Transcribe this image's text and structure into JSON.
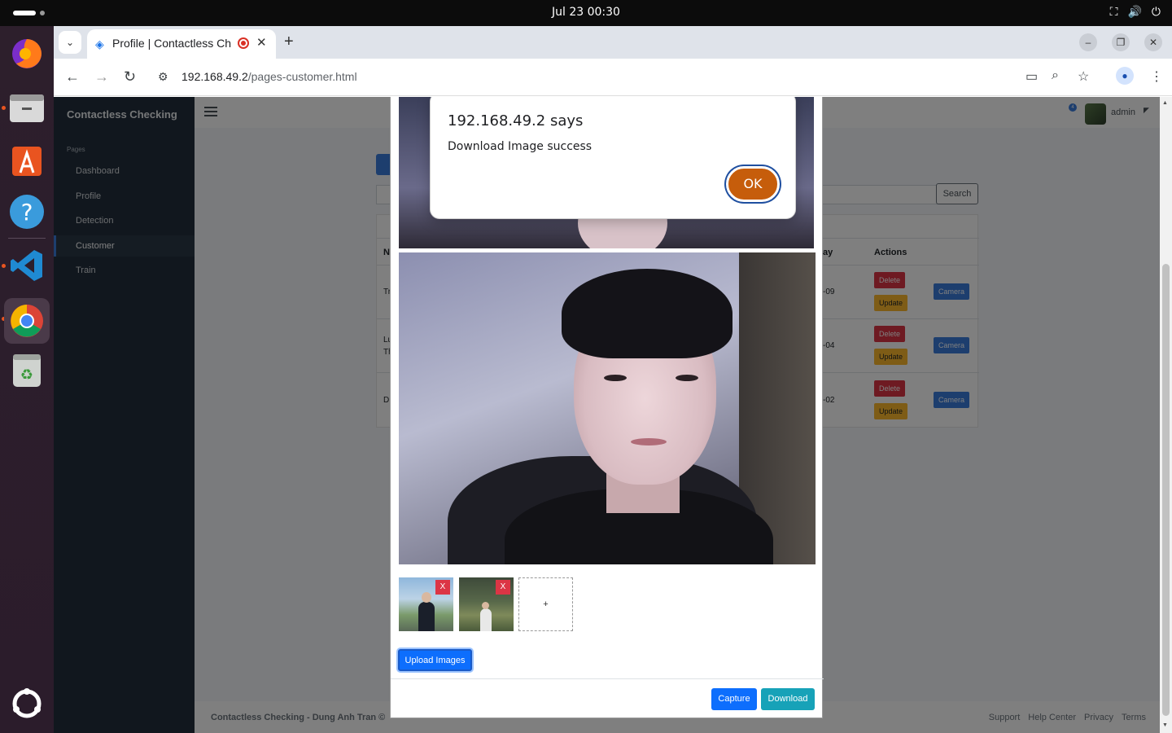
{
  "system": {
    "clock": "Jul 23  00:30",
    "tray_icons": [
      "network-icon",
      "volume-icon",
      "power-icon"
    ]
  },
  "dock": {
    "apps": [
      "firefox",
      "files",
      "app-center",
      "help",
      "vscode",
      "chrome",
      "trash"
    ],
    "active": "chrome"
  },
  "browser": {
    "tab_title": "Profile | Contactless Checking",
    "url_host": "192.168.49.2",
    "url_path": "/pages-customer.html",
    "new_tab_label": "+",
    "tab_close": "✕"
  },
  "sidebar": {
    "brand": "Contactless Checking",
    "section": "Pages",
    "items": [
      {
        "label": "Dashboard",
        "active": false
      },
      {
        "label": "Profile",
        "active": false
      },
      {
        "label": "Detection",
        "active": false
      },
      {
        "label": "Customer",
        "active": true
      },
      {
        "label": "Train",
        "active": false
      }
    ]
  },
  "header": {
    "notification_count": "4",
    "username": "admin"
  },
  "customers": {
    "search_button": "Search",
    "columns": [
      "Na",
      "ay",
      "Actions"
    ],
    "rows": [
      {
        "name_part": "Tr",
        "date_part": "-09",
        "delete": "Delete",
        "update": "Update",
        "camera": "Camera"
      },
      {
        "name_part": "Lu",
        "name_part2": "Th",
        "date_part": "-04",
        "delete": "Delete",
        "update": "Update",
        "camera": "Camera"
      },
      {
        "name_part": "D",
        "date_part": "-02",
        "delete": "Delete",
        "update": "Update",
        "camera": "Camera"
      }
    ]
  },
  "footer": {
    "credit": "Contactless Checking - Dung Anh Tran ©",
    "links": [
      "Support",
      "Help Center",
      "Privacy",
      "Terms"
    ]
  },
  "modal": {
    "thumb_remove": "X",
    "add_image": "+",
    "upload_button": "Upload Images",
    "capture_button": "Capture",
    "download_button": "Download"
  },
  "alert": {
    "origin": "192.168.49.2 says",
    "message": "Download Image success",
    "ok_button": "OK"
  }
}
